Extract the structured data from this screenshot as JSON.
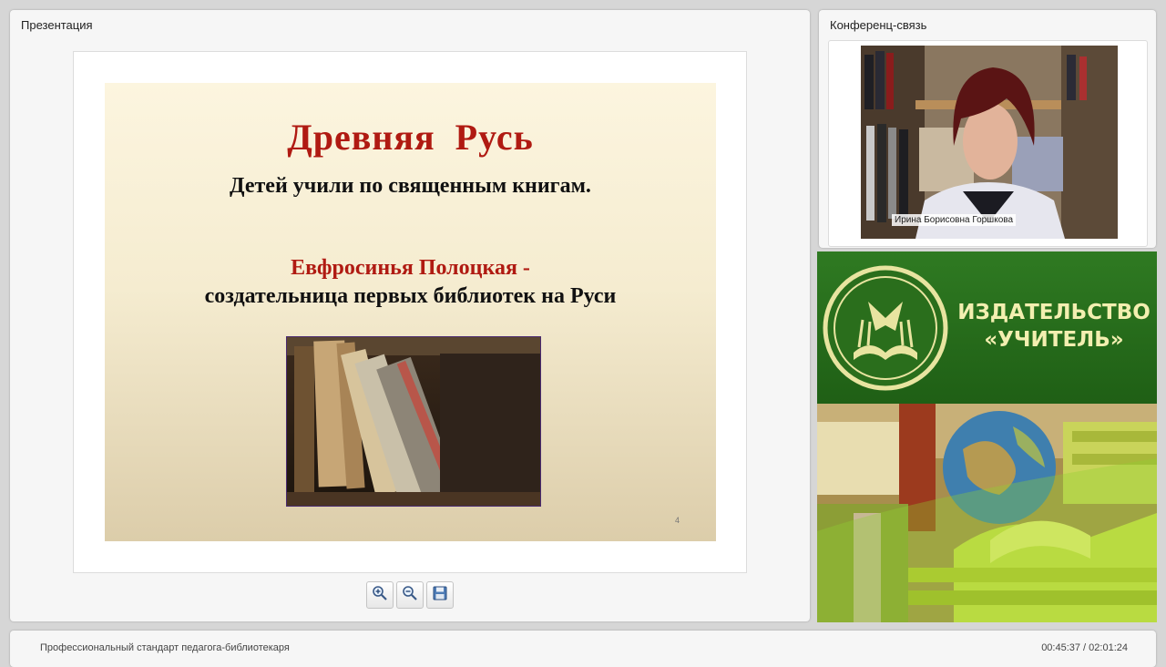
{
  "presentation_panel": {
    "title": "Презентация"
  },
  "slide": {
    "title": "Древняя  Русь",
    "subtitle": "Детей учили по священным книгам.",
    "name": "Евфросинья Полоцкая -",
    "description": "создательница первых библиотек на Руси",
    "page_number": "4"
  },
  "toolbar": {
    "zoom_in_icon": "magnifier-plus-icon",
    "zoom_out_icon": "magnifier-minus-icon",
    "save_icon": "floppy-disk-icon"
  },
  "conference_panel": {
    "title": "Конференц-связь",
    "speaker_name": "Ирина Борисовна Горшкова"
  },
  "brand": {
    "line1": "ИЗДАТЕЛЬСТВО",
    "line2": "«УЧИТЕЛЬ»",
    "color": "#2f7a22"
  },
  "footer": {
    "course_title": "Профессиональный стандарт педагога-библиотекаря",
    "time": "00:45:37 / 02:01:24"
  }
}
